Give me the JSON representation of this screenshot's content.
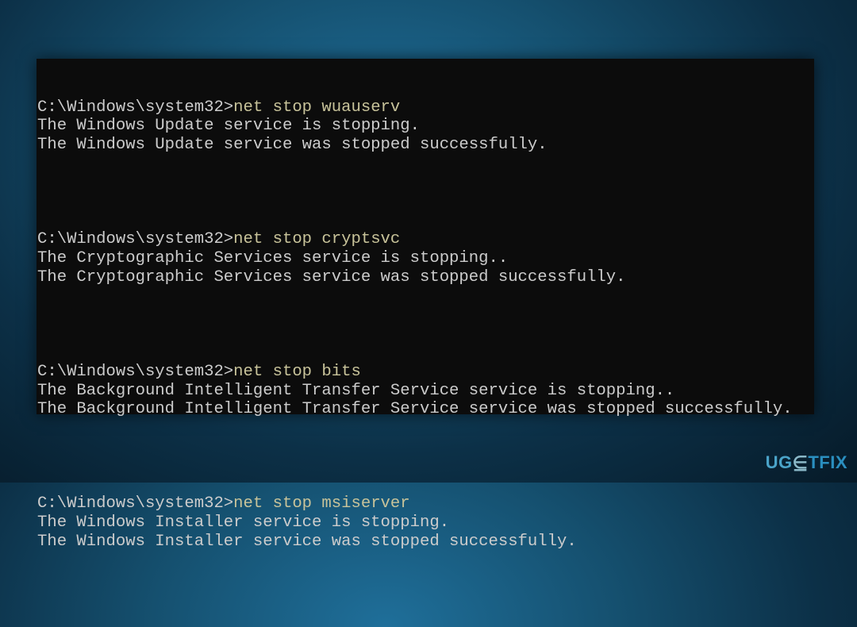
{
  "terminal": {
    "prompt": "C:\\Windows\\system32>",
    "groups": [
      {
        "command": "net stop wuauserv",
        "output": [
          "The Windows Update service is stopping.",
          "The Windows Update service was stopped successfully."
        ]
      },
      {
        "command": "net stop cryptsvc",
        "output": [
          "The Cryptographic Services service is stopping..",
          "The Cryptographic Services service was stopped successfully."
        ]
      },
      {
        "command": "net stop bits",
        "output": [
          "The Background Intelligent Transfer Service service is stopping..",
          "The Background Intelligent Transfer Service service was stopped successfully."
        ]
      },
      {
        "command": "net stop msiserver",
        "output": [
          "The Windows Installer service is stopping.",
          "The Windows Installer service was stopped successfully."
        ]
      }
    ],
    "colors": {
      "background": "#0c0c0c",
      "text": "#cccccc",
      "command": "#c8c39a"
    }
  },
  "logo": {
    "text": "UGETFIX",
    "part1": "UG",
    "part2": "⋸",
    "part3": "TFIX"
  }
}
